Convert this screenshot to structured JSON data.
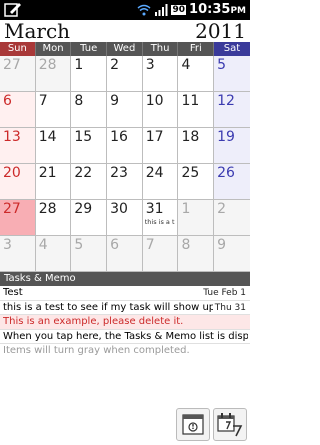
{
  "status_bar": {
    "time": "10:35",
    "battery": "90",
    "time_suffix": "PM"
  },
  "header": {
    "month": "March",
    "year": "2011"
  },
  "weekdays": [
    "Sun",
    "Mon",
    "Tue",
    "Wed",
    "Thu",
    "Fri",
    "Sat"
  ],
  "weeks": [
    [
      "27",
      "28",
      "1",
      "2",
      "3",
      "4",
      "5"
    ],
    [
      "6",
      "7",
      "8",
      "9",
      "10",
      "11",
      "12"
    ],
    [
      "13",
      "14",
      "15",
      "16",
      "17",
      "18",
      "19"
    ],
    [
      "20",
      "21",
      "22",
      "23",
      "24",
      "25",
      "26"
    ],
    [
      "27",
      "28",
      "29",
      "30",
      "31",
      "1",
      "2"
    ],
    [
      "3",
      "4",
      "5",
      "6",
      "7",
      "8",
      "9"
    ]
  ],
  "calendar_event": "this is a t",
  "tasks_header": "Tasks & Memo",
  "tasks": [
    {
      "text": "Test",
      "date": "Tue Feb 1"
    },
    {
      "text": "this is a test to see if my task will show up in",
      "date": "Thu 31"
    },
    {
      "text": "This is an example, please delete it.",
      "date": ""
    },
    {
      "text": "When you tap here, the Tasks & Memo list is displa",
      "date": ""
    },
    {
      "text": "Items will turn gray when completed.",
      "date": ""
    }
  ],
  "icons": {
    "memo": "memo-icon",
    "calendar_today": "calendar-today-icon",
    "brand_color": "#3a3a9a",
    "sunday_color": "#cc2a2a"
  }
}
